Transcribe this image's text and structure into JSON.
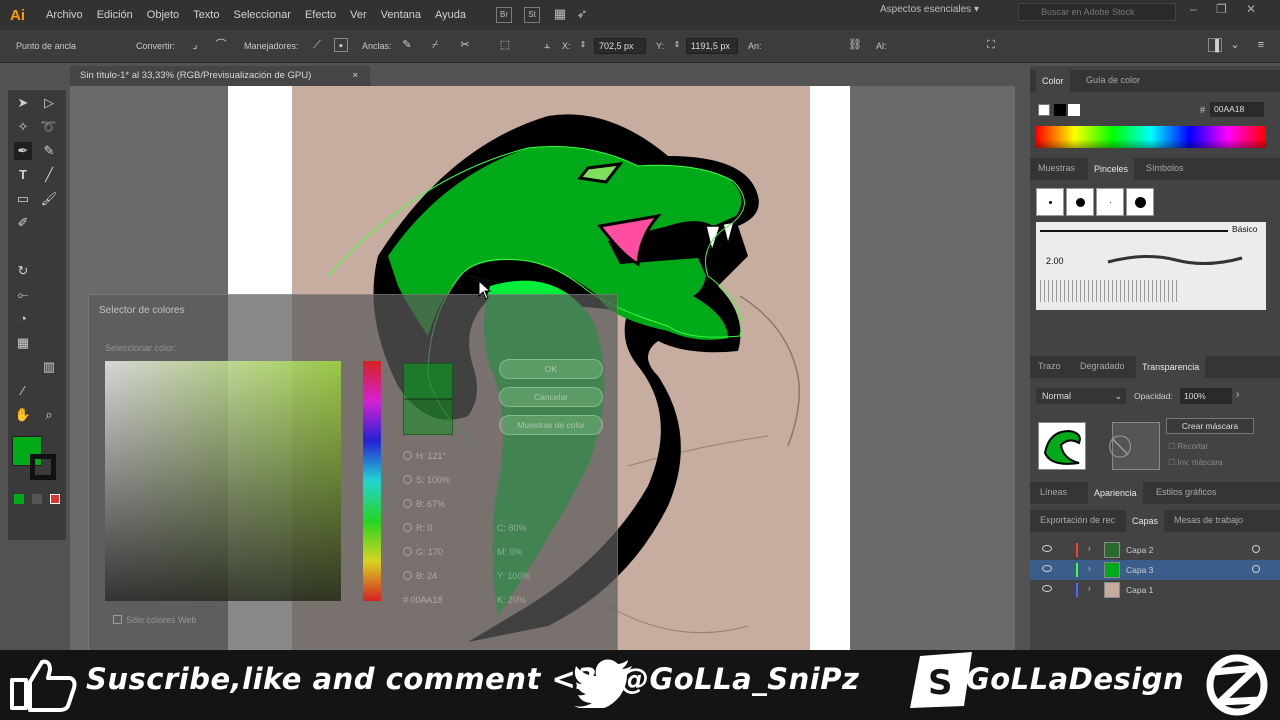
{
  "menubar": {
    "logo": "Ai",
    "items": [
      "Archivo",
      "Edición",
      "Objeto",
      "Texto",
      "Seleccionar",
      "Efecto",
      "Ver",
      "Ventana",
      "Ayuda"
    ],
    "bridge": "Br",
    "stock": "St",
    "workspace": "Aspectos esenciales",
    "search_placeholder": "Buscar en Adobe Stock"
  },
  "controlbar": {
    "tool_name": "Punto de ancla",
    "convert": "Convertir:",
    "handles": "Manejadores:",
    "anchors": "Anclas:",
    "x_label": "X:",
    "x_value": "702,5 px",
    "y_label": "Y:",
    "y_value": "1191,5 px",
    "w_label": "An:",
    "h_label": "Al:"
  },
  "document": {
    "tab_title": "Sin título-1* al 33,33% (RGB/Previsualización de GPU)",
    "close": "×"
  },
  "picker": {
    "title": "Selector de colores",
    "subtitle": "Seleccionar color:",
    "ok": "OK",
    "cancel": "Cancelar",
    "swatches": "Muestras de color",
    "fields": [
      {
        "label": "H:",
        "value": "121°"
      },
      {
        "label": "S:",
        "value": "100%"
      },
      {
        "label": "B:",
        "value": "67%"
      },
      {
        "label": "R:",
        "value": "0"
      },
      {
        "label": "G:",
        "value": "170"
      },
      {
        "label": "B:",
        "value": "24"
      }
    ],
    "cmyk": [
      {
        "label": "C:",
        "value": "80%"
      },
      {
        "label": "M:",
        "value": "0%"
      },
      {
        "label": "Y:",
        "value": "100%"
      },
      {
        "label": "K:",
        "value": "20%"
      }
    ],
    "hex_label": "#",
    "hex_value": "00AA18",
    "web_only": "Sólo colores Web"
  },
  "panels": {
    "color_tabs": [
      "Color",
      "Guía de color"
    ],
    "hex_value": "00AA18",
    "brush_tabs": [
      "Muestras",
      "Pinceles",
      "Símbolos"
    ],
    "brush_basic": "Básico",
    "brush_size": "2.00",
    "stroke_tabs": [
      "Trazo",
      "Degradado",
      "Transparencia"
    ],
    "blend_mode": "Normal",
    "opacity_label": "Opacidad:",
    "opacity_value": "100%",
    "make_mask": "Crear máscara",
    "clip": "Recortar",
    "invert_mask": "Inv. máscara",
    "appearance_tabs": [
      "Líneas",
      "Apariencia",
      "Estilos gráficos"
    ],
    "layer_tabs": [
      "Exportación de rec",
      "Capas",
      "Mesas de trabajo"
    ],
    "layers": [
      {
        "name": "Capa 2",
        "color": "#ff3a3a",
        "selected": false
      },
      {
        "name": "Capa 3",
        "color": "#3aff3a",
        "selected": true
      },
      {
        "name": "Capa 1",
        "color": "#4a6bff",
        "selected": false
      }
    ]
  },
  "banner": {
    "subscribe": "Suscribe,like and comment <3",
    "twitter": "@GoLLa_SniPz",
    "brand": "GoLLaDesign"
  },
  "colors": {
    "snake_fill": "#00aa18",
    "snake_tail": "#00ee3a",
    "tongue": "#ff4da0",
    "accent_selected": "#3a5d8a"
  }
}
